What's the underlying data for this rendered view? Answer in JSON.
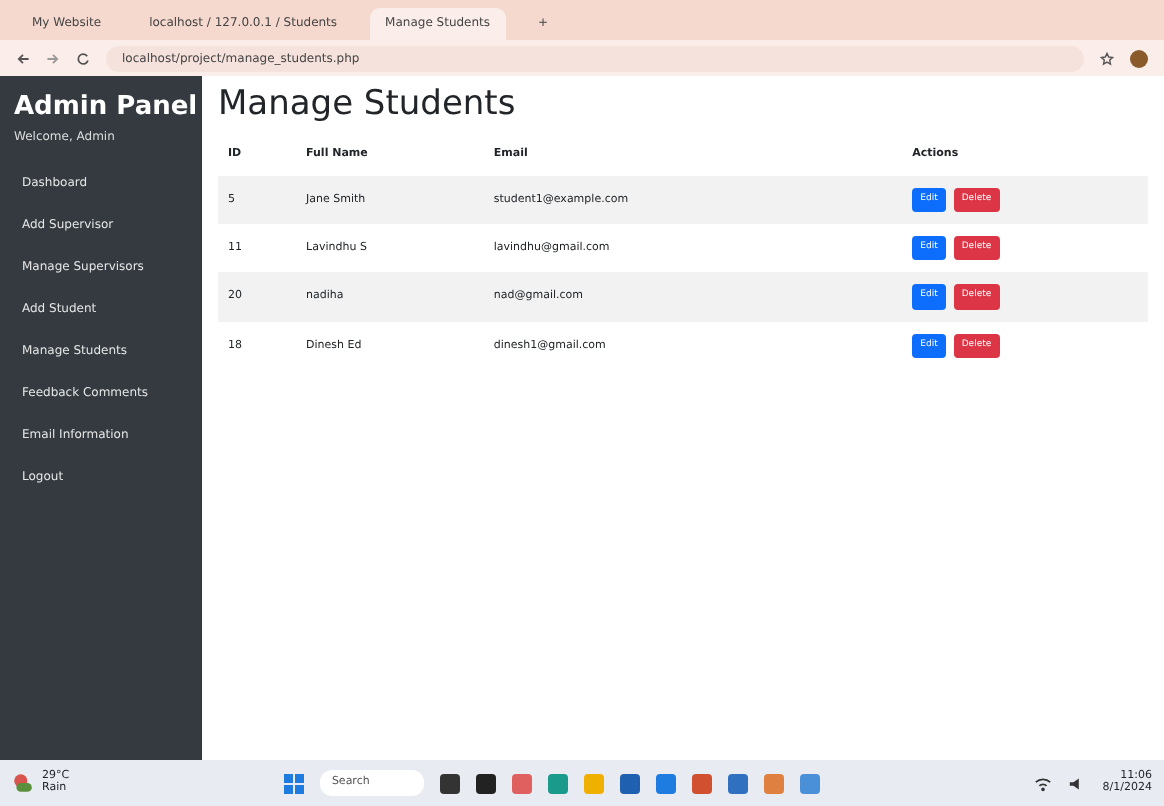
{
  "browser": {
    "tabs": [
      {
        "label": "My Website",
        "selected": false
      },
      {
        "label": "localhost / 127.0.0.1 / Students",
        "selected": false
      },
      {
        "label": "Manage Students",
        "selected": true
      }
    ],
    "new_tab": "+",
    "address": "localhost/project/manage_students.php"
  },
  "sidebar": {
    "title": "Admin Panel",
    "welcome": "Welcome, Admin",
    "items": [
      {
        "label": "Dashboard"
      },
      {
        "label": "Add Supervisor"
      },
      {
        "label": "Manage Supervisors"
      },
      {
        "label": "Add Student"
      },
      {
        "label": "Manage Students"
      },
      {
        "label": "Feedback Comments"
      },
      {
        "label": "Email Information"
      },
      {
        "label": "Logout"
      }
    ]
  },
  "page": {
    "title": "Manage Students"
  },
  "table": {
    "columns": [
      "ID",
      "Full Name",
      "Email",
      "Actions"
    ],
    "rows": [
      {
        "id": "5",
        "name": "Jane Smith",
        "email": "student1@example.com",
        "buttons": [
          "Edit",
          "Delete"
        ]
      },
      {
        "id": "11",
        "name": "Lavindhu S",
        "email": "lavindhu@gmail.com",
        "buttons": [
          "Edit",
          "Delete"
        ]
      },
      {
        "id": "20",
        "name": "nadiha",
        "email": "nad@gmail.com",
        "buttons": [
          "Edit",
          "Delete"
        ]
      },
      {
        "id": "18",
        "name": "Dinesh Ed",
        "email": "dinesh1@gmail.com",
        "buttons": [
          "Edit",
          "Delete"
        ]
      }
    ]
  },
  "taskbar": {
    "weather": "29°C",
    "weather_note": "Rain",
    "search": "Search",
    "time": "11:06",
    "date": "8/1/2024"
  }
}
